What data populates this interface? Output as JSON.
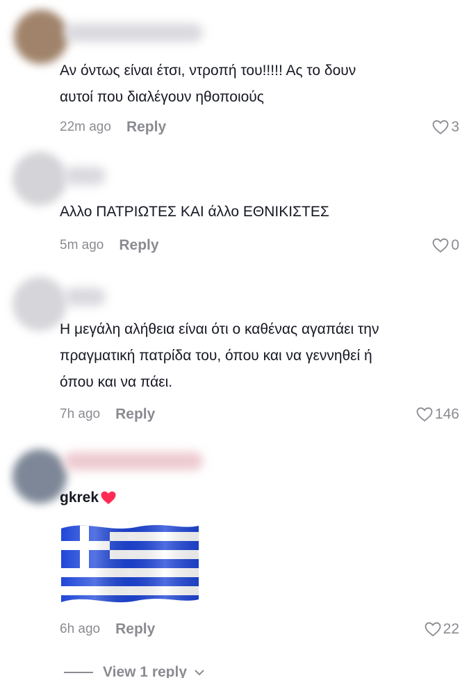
{
  "comments": [
    {
      "text_lines": [
        "Αν όντως είναι έτσι, ντροπή του!!!!! Ας το δουν",
        "αυτοί που διαλέγουν ηθοποιούς"
      ],
      "time": "22m ago",
      "reply_label": "Reply",
      "likes": "3"
    },
    {
      "text_lines": [
        "Αλλο ΠΑΤΡΙΩΤΕΣ ΚΑΙ άλλο ΕΘΝΙΚΙΣΤΕΣ"
      ],
      "time": "5m ago",
      "reply_label": "Reply",
      "likes": "0"
    },
    {
      "text_lines": [
        "Η μεγάλη αλήθεια είναι ότι ο καθένας αγαπάει την",
        "πραγματική πατρίδα του, όπου και να γεννηθεί ή",
        "όπου και να πάει."
      ],
      "time": "7h ago",
      "reply_label": "Reply",
      "likes": "146"
    },
    {
      "username": "gkrek",
      "time": "6h ago",
      "reply_label": "Reply",
      "likes": "22"
    }
  ],
  "view_replies_label": "View 1 reply",
  "colors": {
    "text": "#161823",
    "muted": "#8a8b91",
    "heart": "#fe2c55",
    "flag_blue": "#1e45d8"
  },
  "icons": {
    "like": "heart-outline-icon",
    "username_suffix": "heart-filled-icon",
    "expand": "chevron-down-icon"
  }
}
